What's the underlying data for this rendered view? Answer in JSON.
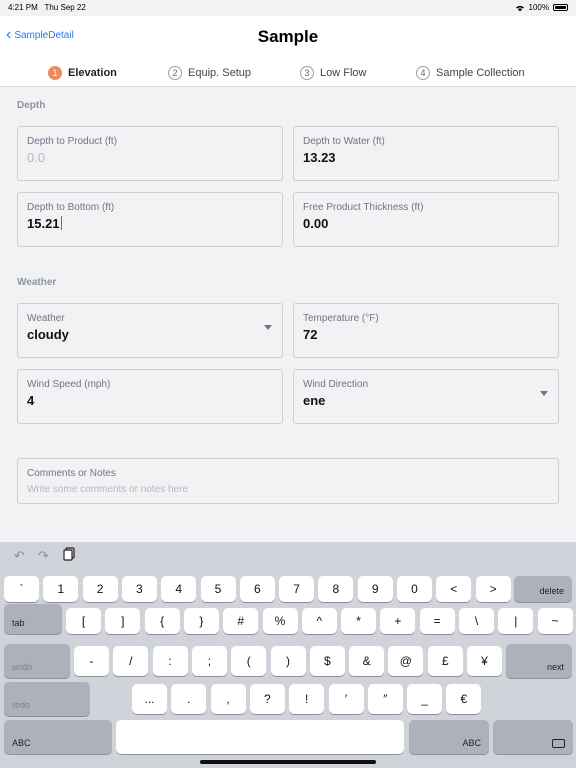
{
  "status": {
    "time": "4:21 PM",
    "date": "Thu Sep 22",
    "battery": "100%"
  },
  "nav": {
    "back_label": "SampleDetail",
    "title": "Sample"
  },
  "steps": [
    {
      "num": "1",
      "label": "Elevation"
    },
    {
      "num": "2",
      "label": "Equip. Setup"
    },
    {
      "num": "3",
      "label": "Low Flow"
    },
    {
      "num": "4",
      "label": "Sample Collection"
    }
  ],
  "depth": {
    "section": "Depth",
    "product": {
      "label": "Depth to Product (ft)",
      "placeholder": "0.0"
    },
    "water": {
      "label": "Depth to Water (ft)",
      "value": "13.23"
    },
    "bottom": {
      "label": "Depth to Bottom (ft)",
      "value": "15.21"
    },
    "thickness": {
      "label": "Free Product Thickness (ft)",
      "value": "0.00"
    }
  },
  "weather": {
    "section": "Weather",
    "weather": {
      "label": "Weather",
      "value": "cloudy"
    },
    "temperature": {
      "label": "Temperature (°F)",
      "value": "72"
    },
    "wind_speed": {
      "label": "Wind Speed (mph)",
      "value": "4"
    },
    "wind_direction": {
      "label": "Wind Direction",
      "value": "ene"
    }
  },
  "comments": {
    "label": "Comments or Notes",
    "placeholder": "Write some comments or notes here"
  },
  "keyboard": {
    "row1": [
      "`",
      "1",
      "2",
      "3",
      "4",
      "5",
      "6",
      "7",
      "8",
      "9",
      "0",
      "<",
      ">"
    ],
    "delete": "delete",
    "tab": "tab",
    "row2": [
      "[",
      "]",
      "{",
      "}",
      "#",
      "%",
      "^",
      "*",
      "+",
      "=",
      "\\",
      "|",
      "~"
    ],
    "undo": "undo",
    "row3": [
      "-",
      "/",
      ":",
      ";",
      "(",
      ")",
      "$",
      "&",
      "@",
      "£",
      "¥"
    ],
    "next": "next",
    "redo": "redo",
    "row4": [
      "...",
      ".",
      ",",
      "?",
      "!",
      "′",
      "″",
      "_",
      "€"
    ],
    "abc_left": "ABC",
    "abc_right": "ABC"
  }
}
